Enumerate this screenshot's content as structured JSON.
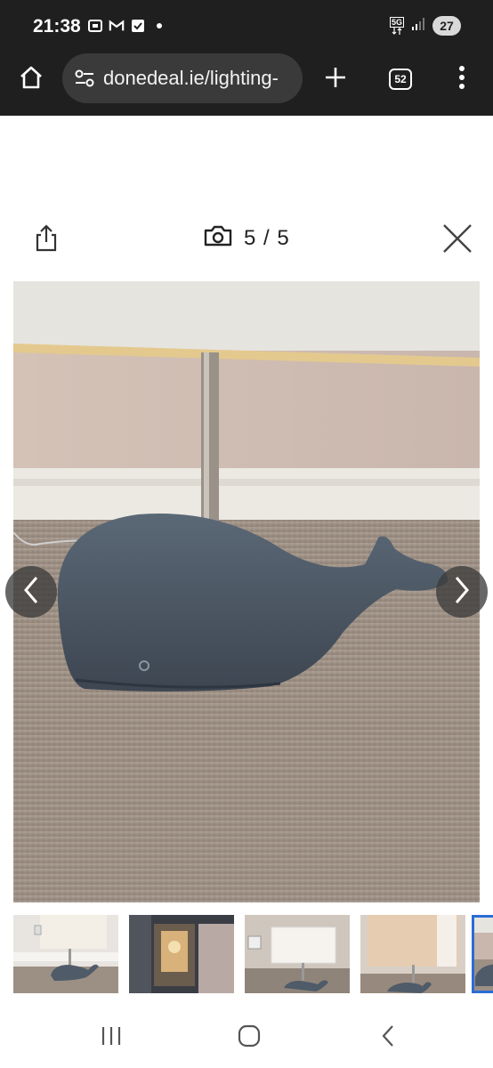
{
  "status_bar": {
    "time": "21:38",
    "battery_level": "27",
    "network_label": "5G",
    "left_icons": [
      "screenshot-icon",
      "gmail-icon",
      "checkbox-icon",
      "dot-icon"
    ],
    "right_icons": [
      "network-5g-icon",
      "signal-icon",
      "battery-icon"
    ]
  },
  "browser": {
    "url": "donedeal.ie/lighting-",
    "tab_count": "52",
    "icons": [
      "home-icon",
      "tune-icon",
      "plus-icon",
      "tabs-icon",
      "more-vert-icon"
    ]
  },
  "gallery": {
    "counter": "5 / 5",
    "current": 5,
    "total": 5,
    "icons": [
      "share-icon",
      "camera-icon",
      "close-icon",
      "chevron-left-icon",
      "chevron-right-icon"
    ],
    "thumbnails": [
      {
        "description": "whale lamp with shade"
      },
      {
        "description": "lamp in dark room"
      },
      {
        "description": "lamp by wall socket"
      },
      {
        "description": "lamp with white shade"
      },
      {
        "description": "whale base close-up"
      }
    ]
  },
  "colors": {
    "chrome_background": "#1f1f1f",
    "url_pill": "#3a3a3a",
    "selected_thumb_outline": "#2b6cd4",
    "whale_blue": "#4f5b68"
  },
  "android_nav": {
    "icons": [
      "recent-apps-icon",
      "home-circle-icon",
      "back-icon"
    ]
  }
}
